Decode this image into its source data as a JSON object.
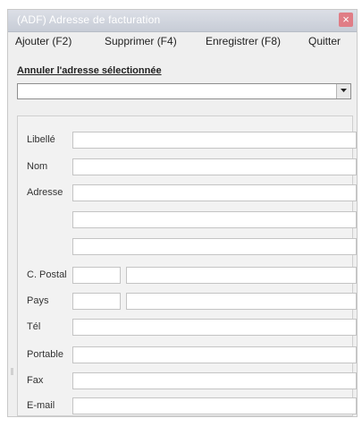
{
  "window": {
    "title": "(ADF) Adresse de facturation",
    "close_glyph": "×"
  },
  "menu": {
    "add": "Ajouter (F2)",
    "delete": "Supprimer (F4)",
    "save": "Enregistrer (F8)",
    "quit": "Quitter"
  },
  "cancel_link": "Annuler l'adresse sélectionnée",
  "address_select": {
    "value": ""
  },
  "form": {
    "libelle": {
      "label": "Libellé",
      "value": ""
    },
    "nom": {
      "label": "Nom",
      "value": ""
    },
    "adresse": {
      "label": "Adresse",
      "line1": "",
      "line2": "",
      "line3": ""
    },
    "cp": {
      "label": "C. Postal",
      "code": "",
      "ville": ""
    },
    "pays": {
      "label": "Pays",
      "code": "",
      "nom": ""
    },
    "tel": {
      "label": "Tél",
      "value": ""
    },
    "portable": {
      "label": "Portable",
      "value": ""
    },
    "fax": {
      "label": "Fax",
      "value": ""
    },
    "email": {
      "label": "E-mail",
      "value": ""
    }
  },
  "colors": {
    "titlebar": "#c7ccd6",
    "close_button": "#e07d86",
    "window_bg": "#efefef"
  }
}
